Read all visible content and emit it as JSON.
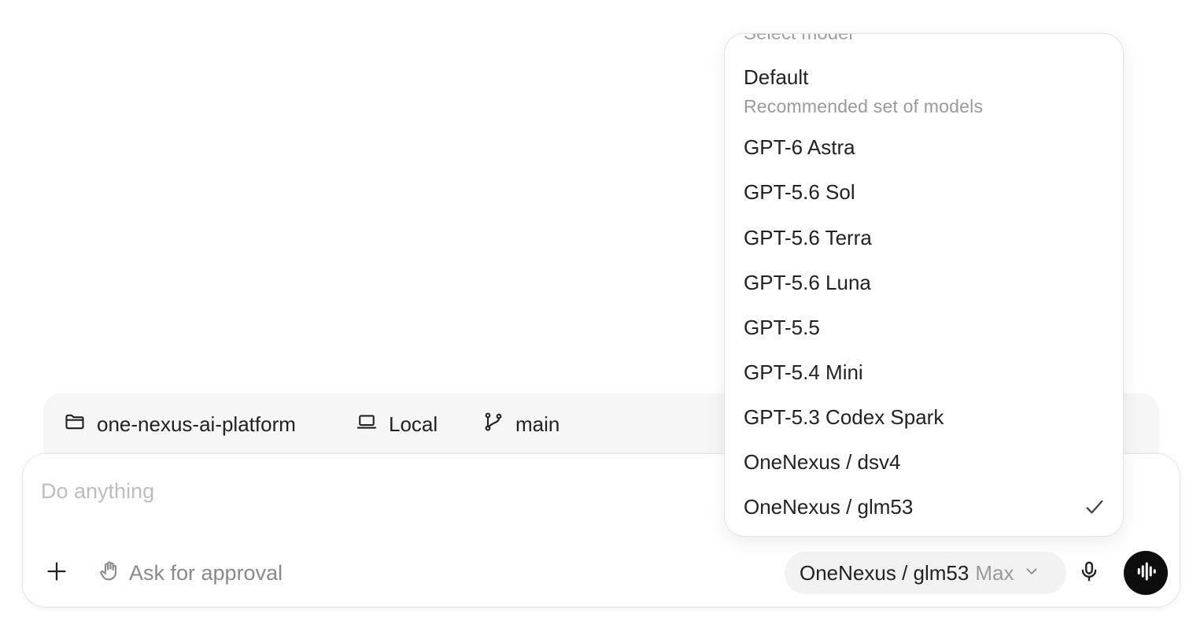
{
  "context": {
    "project": "one-nexus-ai-platform",
    "environment": "Local",
    "branch": "main"
  },
  "composer": {
    "placeholder": "Do anything",
    "value": "",
    "approval_label": "Ask for approval",
    "selected_model": "OneNexus / glm53",
    "effort": "Max"
  },
  "model_menu": {
    "header": "Select model",
    "default": {
      "label": "Default",
      "description": "Recommended set of models"
    },
    "items": [
      {
        "label": "GPT-6 Astra",
        "selected": false
      },
      {
        "label": "GPT-5.6 Sol",
        "selected": false
      },
      {
        "label": "GPT-5.6 Terra",
        "selected": false
      },
      {
        "label": "GPT-5.6 Luna",
        "selected": false
      },
      {
        "label": "GPT-5.5",
        "selected": false
      },
      {
        "label": "GPT-5.4 Mini",
        "selected": false
      },
      {
        "label": "GPT-5.3 Codex Spark",
        "selected": false
      },
      {
        "label": "OneNexus / dsv4",
        "selected": false
      },
      {
        "label": "OneNexus / glm53",
        "selected": true
      }
    ]
  },
  "icons": {
    "project": "folder-icon",
    "environment": "laptop-icon",
    "branch": "git-branch-icon",
    "add": "plus-icon",
    "approval": "hand-icon",
    "model_chevron": "chevron-down-icon",
    "mic": "microphone-icon",
    "voice": "voice-waveform-icon",
    "selected": "checkmark-icon"
  },
  "colors": {
    "voice_button_bg": "#0d0d0d",
    "placeholder": "#bdbdbd",
    "muted_text": "#9a9a9a",
    "pill_bg": "#f2f2f2"
  }
}
